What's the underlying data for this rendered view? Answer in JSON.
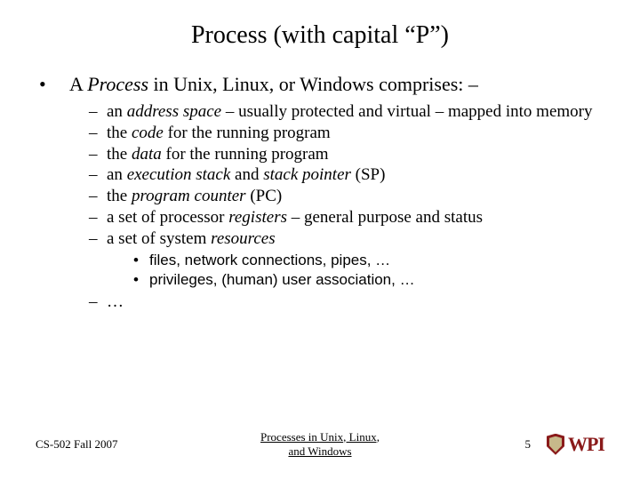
{
  "title": "Process (with capital “P”)",
  "mainBullet": {
    "prefix": "A ",
    "process": "Process",
    "rest": " in Unix, Linux, or Windows comprises: –"
  },
  "subItems": [
    {
      "segments": [
        "an ",
        {
          "i": "address space"
        },
        " – usually protected and virtual – mapped into memory"
      ]
    },
    {
      "segments": [
        "the ",
        {
          "i": "code"
        },
        " for the running program"
      ]
    },
    {
      "segments": [
        "the ",
        {
          "i": "data"
        },
        " for the running program"
      ]
    },
    {
      "segments": [
        "an ",
        {
          "i": "execution stack"
        },
        " and ",
        {
          "i": "stack pointer"
        },
        " (SP)"
      ]
    },
    {
      "segments": [
        "the ",
        {
          "i": "program counter"
        },
        " (PC)"
      ]
    },
    {
      "segments": [
        "a set of processor ",
        {
          "i": "registers"
        },
        " – general purpose and status"
      ]
    },
    {
      "segments": [
        "a set of system ",
        {
          "i": "resources"
        }
      ]
    }
  ],
  "subSubItems": [
    "files, network connections, pipes, …",
    "privileges, (human) user association, …"
  ],
  "ellipsis": "…",
  "footer": {
    "left": "CS-502 Fall 2007",
    "centerLine1": "Processes in Unix, Linux,",
    "centerLine2": "and Windows",
    "page": "5",
    "logoText": "WPI"
  }
}
